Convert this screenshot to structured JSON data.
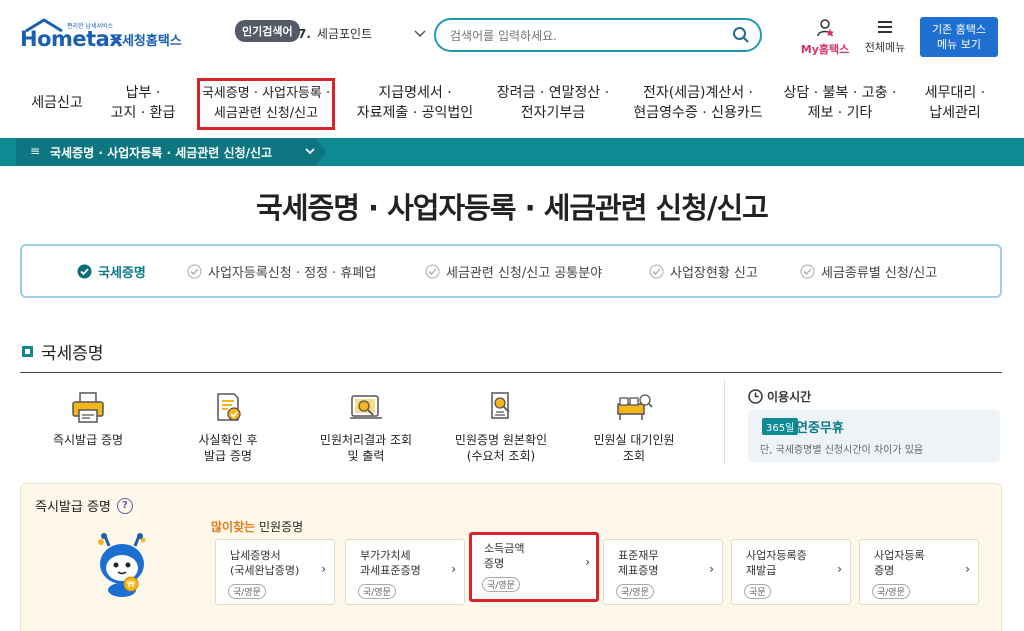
{
  "header": {
    "logo_word": "Hometax",
    "logo_small": "편리한 납세서비스",
    "logo_kor": "국세청홈택스",
    "popular_badge": "인기검색어",
    "popular_num": "7.",
    "popular_term": "세금포인트",
    "search_placeholder": "검색어를 입력하세요.",
    "my_prefix": "My",
    "my_suffix": "홈택스",
    "all_menu": "전체메뉴",
    "old_menu_line1": "기존 홈택스",
    "old_menu_line2": "메뉴 보기"
  },
  "gnb": [
    {
      "line1": "세금신고",
      "line2": ""
    },
    {
      "line1": "납부 ·",
      "line2": "고지 · 환급"
    },
    {
      "line1": "국세증명 · 사업자등록 ·",
      "line2": "세금관련 신청/신고"
    },
    {
      "line1": "지급명세서 ·",
      "line2": "자료제출 · 공익법인"
    },
    {
      "line1": "장려금 · 연말정산 ·",
      "line2": "전자기부금"
    },
    {
      "line1": "전자(세금)계산서 ·",
      "line2": "현금영수증 · 신용카드"
    },
    {
      "line1": "상담 · 불복 · 고충 ·",
      "line2": "제보 · 기타"
    },
    {
      "line1": "세무대리 ·",
      "line2": "납세관리"
    }
  ],
  "breadcrumb": {
    "menu_glyph": "≡",
    "text": "국세증명 · 사업자등록 · 세금관련 신청/신고"
  },
  "page_title": "국세증명 · 사업자등록 · 세금관련 신청/신고",
  "subtabs": [
    {
      "label": "국세증명",
      "active": true
    },
    {
      "label": "사업자등록신청 · 정정 · 휴폐업",
      "active": false
    },
    {
      "label": "세금관련 신청/신고 공통분야",
      "active": false
    },
    {
      "label": "사업장현황 신고",
      "active": false
    },
    {
      "label": "세금종류별 신청/신고",
      "active": false
    }
  ],
  "section_title": "국세증명",
  "services": [
    {
      "line1": "즉시발급 증명",
      "line2": "",
      "icon": "printer-icon"
    },
    {
      "line1": "사실확인 후",
      "line2": "발급 증명",
      "icon": "document-check-icon"
    },
    {
      "line1": "민원처리결과 조회",
      "line2": "및 출력",
      "icon": "scroll-search-icon"
    },
    {
      "line1": "민원증명 원본확인",
      "line2": "(수요처 조회)",
      "icon": "certificate-search-icon"
    },
    {
      "line1": "민원실 대기인원",
      "line2": "조회",
      "icon": "waiting-room-icon"
    }
  ],
  "usage": {
    "title": "이용시간",
    "badge": "365일",
    "nonstop": "연중무휴",
    "note": "단, 국세증명별 신청시간이 차이가 있음"
  },
  "instant_panel": {
    "title": "즉시발급 증명",
    "help": "?",
    "freq_orange": "많이찾는",
    "freq_rest": " 민원증명",
    "cards": [
      {
        "line1": "납세증명서",
        "line2": "(국세완납증명)",
        "tag": "국/영문",
        "highlight": false
      },
      {
        "line1": "부가가치세",
        "line2": "과세표준증명",
        "tag": "국/영문",
        "highlight": false
      },
      {
        "line1": "소득금액",
        "line2": "증명",
        "tag": "국/영문",
        "highlight": true
      },
      {
        "line1": "표준재무",
        "line2": "제표증명",
        "tag": "국/영문",
        "highlight": false
      },
      {
        "line1": "사업자등록증",
        "line2": "재발급",
        "tag": "국문",
        "highlight": false
      },
      {
        "line1": "사업자등록",
        "line2": "증명",
        "tag": "국/영문",
        "highlight": false
      }
    ],
    "arrow": "›"
  },
  "colors": {
    "teal": "#0f8a94",
    "highlight_red": "#d9222a",
    "brand_blue": "#1a5fb4"
  }
}
